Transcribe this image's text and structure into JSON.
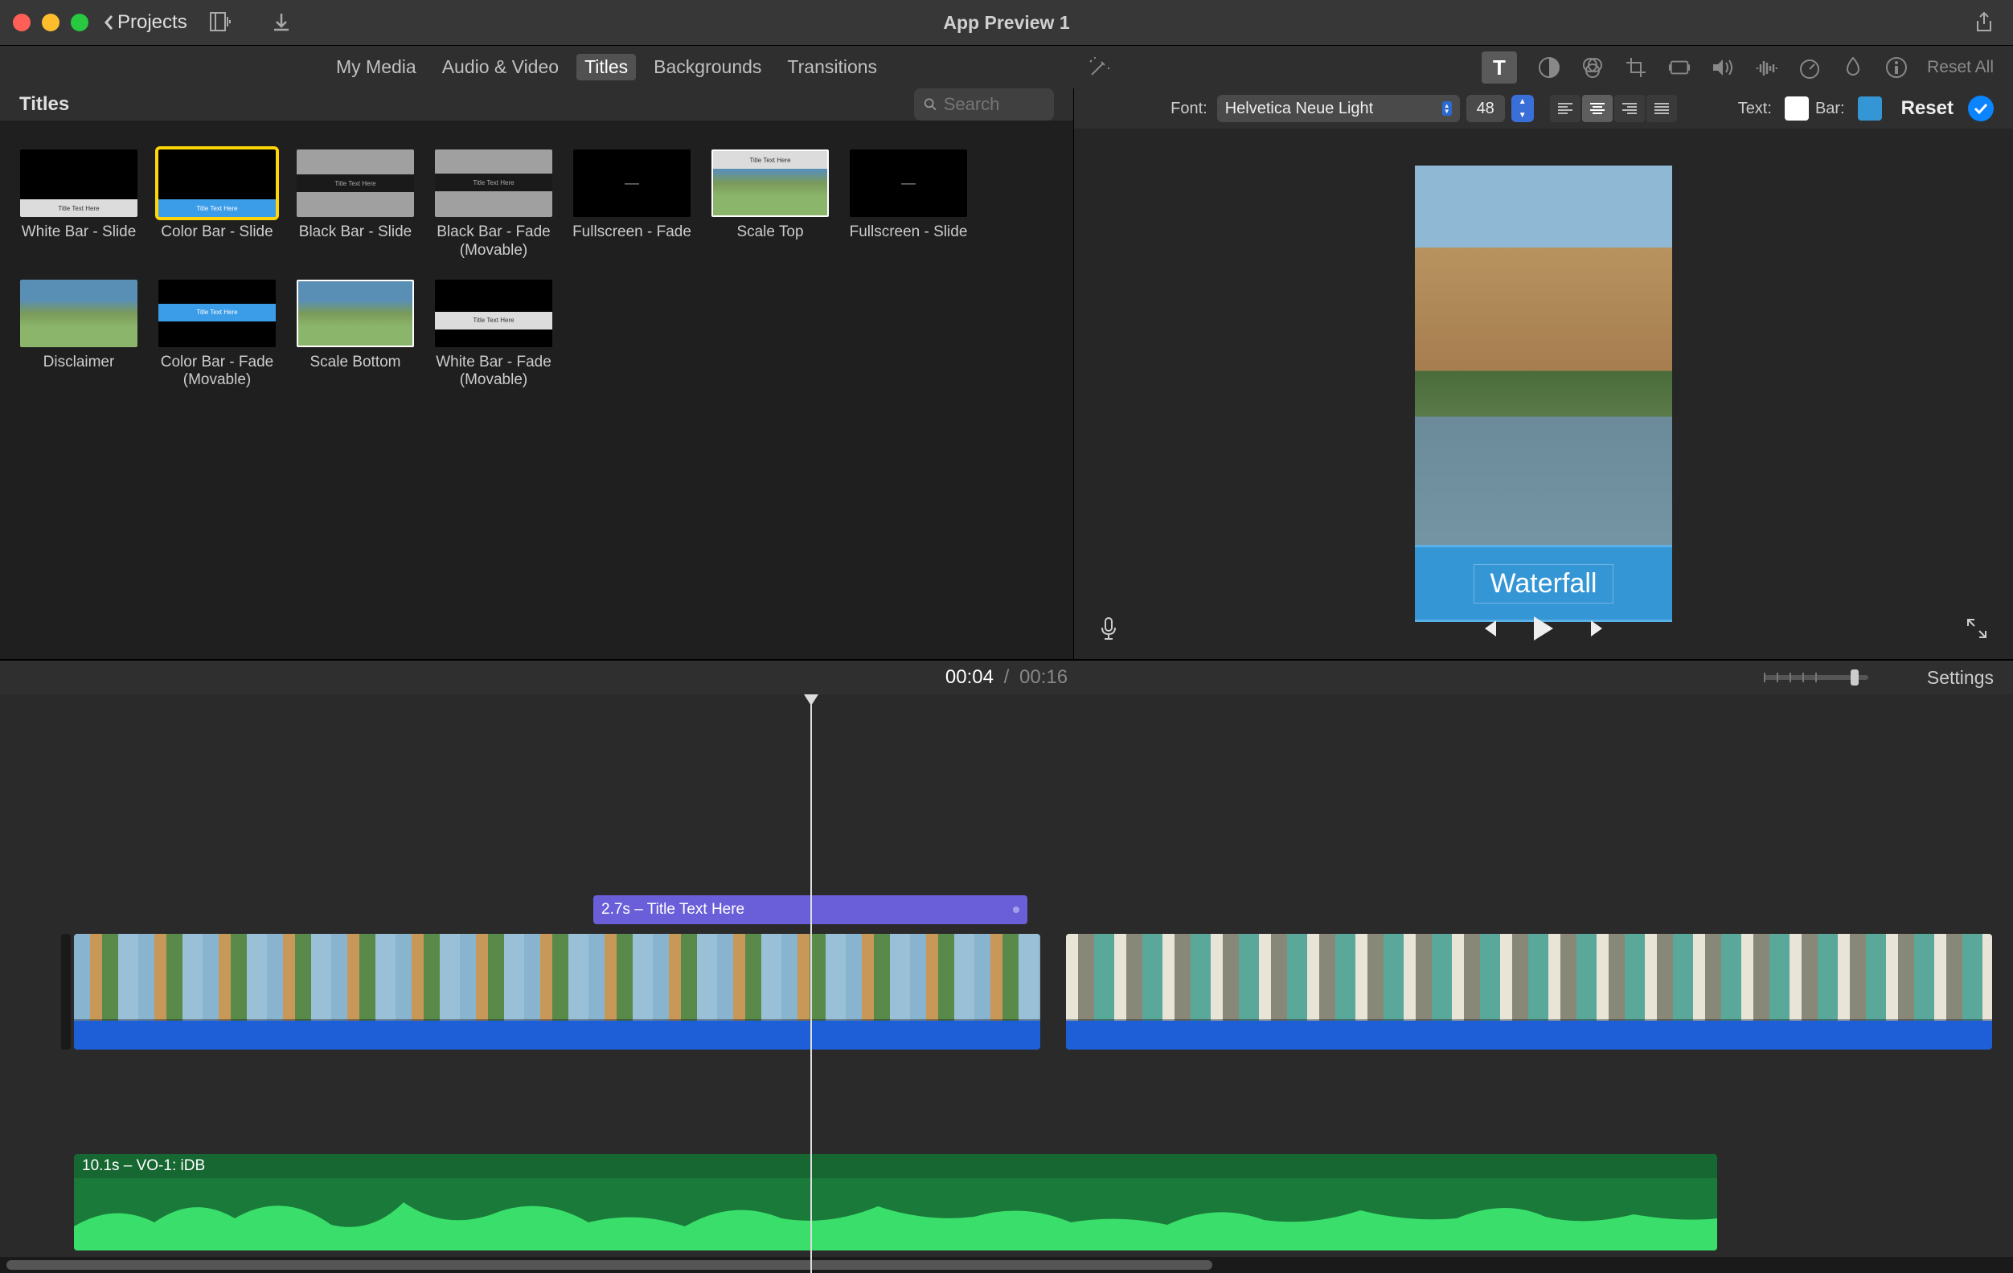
{
  "titleBar": {
    "backLabel": "Projects",
    "appTitle": "App Preview 1"
  },
  "mediaTabs": [
    "My Media",
    "Audio & Video",
    "Titles",
    "Backgrounds",
    "Transitions"
  ],
  "activeMediaTab": 2,
  "toolbar": {
    "resetAll": "Reset All"
  },
  "titlesPanel": {
    "header": "Titles",
    "searchPlaceholder": "Search",
    "items": [
      {
        "name": "White Bar - Slide",
        "style": "white-bottom"
      },
      {
        "name": "Color Bar - Slide",
        "style": "blue-bottom",
        "selected": true
      },
      {
        "name": "Black Bar - Slide",
        "style": "gray-black"
      },
      {
        "name": "Black Bar - Fade (Movable)",
        "style": "gray-black"
      },
      {
        "name": "Fullscreen - Fade",
        "style": "black-dash"
      },
      {
        "name": "Scale Top",
        "style": "image-top"
      },
      {
        "name": "Fullscreen - Slide",
        "style": "black-dash"
      },
      {
        "name": "Disclaimer",
        "style": "image-bottom"
      },
      {
        "name": "Color Bar - Fade (Movable)",
        "style": "blue-mid"
      },
      {
        "name": "Scale Bottom",
        "style": "image-bottom-white"
      },
      {
        "name": "White Bar - Fade (Movable)",
        "style": "white-mid"
      }
    ]
  },
  "inspector": {
    "fontLabel": "Font:",
    "fontName": "Helvetica Neue Light",
    "fontSize": "48",
    "textLabel": "Text:",
    "barLabel": "Bar:",
    "textColor": "#ffffff",
    "barColor": "#3596d6",
    "resetLabel": "Reset"
  },
  "preview": {
    "titleText": "Waterfall"
  },
  "timeline": {
    "currentTime": "00:04",
    "duration": "00:16",
    "settings": "Settings",
    "titleClipLabel": "2.7s – Title Text Here",
    "audioTrackLabel": "10.1s – VO-1: iDB"
  }
}
